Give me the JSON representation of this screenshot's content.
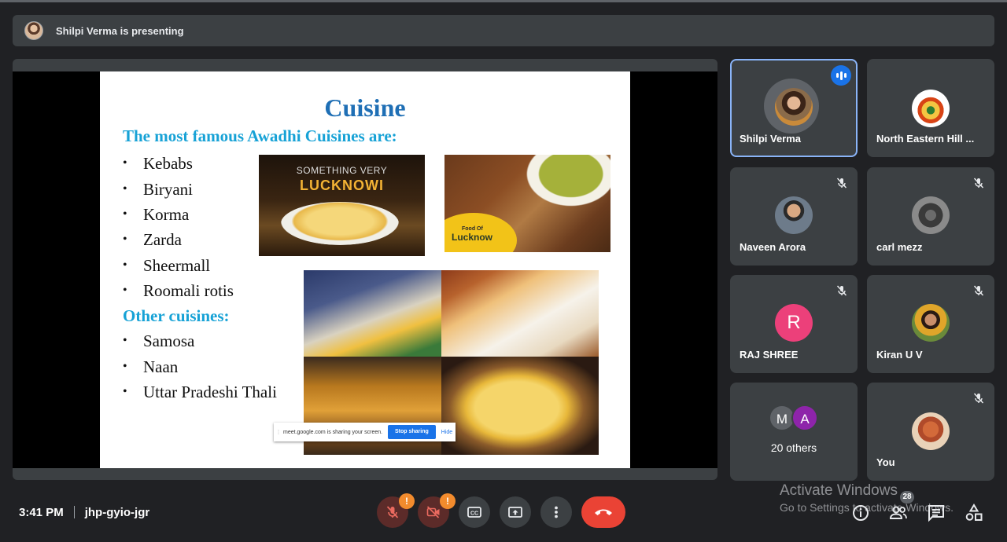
{
  "presenting": {
    "text": "Shilpi Verma is presenting"
  },
  "slide": {
    "title": "Cuisine",
    "section1": "The most famous Awadhi Cuisines are:",
    "list1": [
      "Kebabs",
      "Biryani",
      "Korma",
      "Zarda",
      "Sheermall",
      "Roomali rotis"
    ],
    "section2": "Other cuisines:",
    "list2": [
      "Samosa",
      "Naan",
      "Uttar Pradeshi Thali"
    ],
    "photo1_caption_top": "SOMETHING VERY",
    "photo1_caption_main": "LUCKNOWI",
    "photo2_badge_top": "Food Of",
    "photo2_badge_main": "Lucknow"
  },
  "share_bar": {
    "message": "meet.google.com is sharing your screen.",
    "stop_label": "Stop sharing",
    "hide_label": "Hide"
  },
  "participants": [
    {
      "name": "Shilpi Verma",
      "state": "speaking"
    },
    {
      "name": "North Eastern Hill ...",
      "state": "muted"
    },
    {
      "name": "Naveen Arora",
      "state": "muted"
    },
    {
      "name": "carl mezz",
      "state": "muted"
    },
    {
      "name": "RAJ SHREE",
      "initial": "R",
      "avatar_color": "#ec407a",
      "state": "muted"
    },
    {
      "name": "Kiran U V",
      "state": "muted"
    },
    {
      "label": "20 others",
      "avatars": [
        {
          "initial": "M",
          "color": "#5f6368"
        },
        {
          "initial": "A",
          "color": "#8e24aa"
        }
      ]
    },
    {
      "name": "You",
      "state": "muted"
    }
  ],
  "meeting": {
    "time": "3:41 PM",
    "code": "jhp-gyio-jgr"
  },
  "controls": {
    "mic_warning": "!",
    "camera_warning": "!",
    "people_count": "28"
  },
  "watermark": {
    "line1": "Activate Windows",
    "line2": "Go to Settings to activate Windows."
  },
  "colors": {
    "accent": "#1a73e8",
    "leave": "#ea4335",
    "warning": "#f28b2d"
  }
}
